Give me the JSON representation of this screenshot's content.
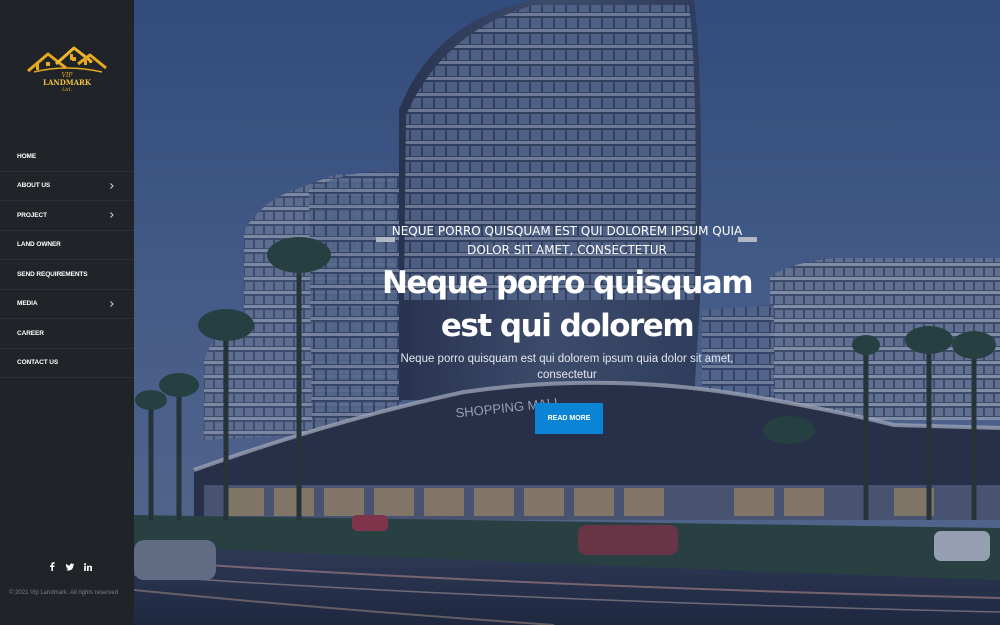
{
  "brand": {
    "logo_text_line1": "VIP",
    "logo_text_line2": "LANDMARK",
    "logo_text_line3": "Ltd."
  },
  "nav": {
    "items": [
      {
        "label": "HOME",
        "has_submenu": false
      },
      {
        "label": "ABOUT US",
        "has_submenu": true
      },
      {
        "label": "PROJECT",
        "has_submenu": true
      },
      {
        "label": "LAND OWNER",
        "has_submenu": false
      },
      {
        "label": "SEND REQUIREMENTS",
        "has_submenu": false
      },
      {
        "label": "MEDIA",
        "has_submenu": true
      },
      {
        "label": "CAREER",
        "has_submenu": false
      },
      {
        "label": "CONTACT US",
        "has_submenu": false
      }
    ]
  },
  "social": {
    "icons": [
      "facebook-icon",
      "twitter-icon",
      "linkedin-icon"
    ]
  },
  "footer": {
    "copyright": "© 2021 Vip Landmark. All rights reserved"
  },
  "hero": {
    "eyebrow": "NEQUE PORRO QUISQUAM EST QUI DOLOREM IPSUM QUIA DOLOR SIT AMET, CONSECTETUR",
    "headline": "Neque porro quisquam est qui dolorem",
    "subtext": "Neque porro quisquam est qui dolorem ipsum quia dolor sit amet, consectetur",
    "cta_label": "READ MORE",
    "building_sign": "SHOPPING MALL"
  },
  "colors": {
    "sidebar_bg": "#202328",
    "cta_bg": "#0b84d6",
    "logo_gold": "#e6a91f"
  }
}
